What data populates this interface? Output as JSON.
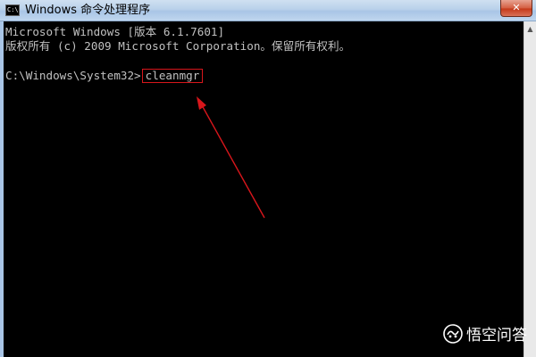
{
  "window": {
    "title": "Windows 命令处理程序",
    "icon_label": "C:\\",
    "close_glyph": "✕"
  },
  "console": {
    "lines": [
      "Microsoft Windows [版本 6.1.7601]",
      "版权所有 (c) 2009 Microsoft Corporation。保留所有权利。"
    ],
    "prompt": "C:\\Windows\\System32>",
    "command": "cleanmgr"
  },
  "annotation": {
    "color": "#d8161b"
  },
  "watermark": {
    "text": "悟空问答"
  }
}
